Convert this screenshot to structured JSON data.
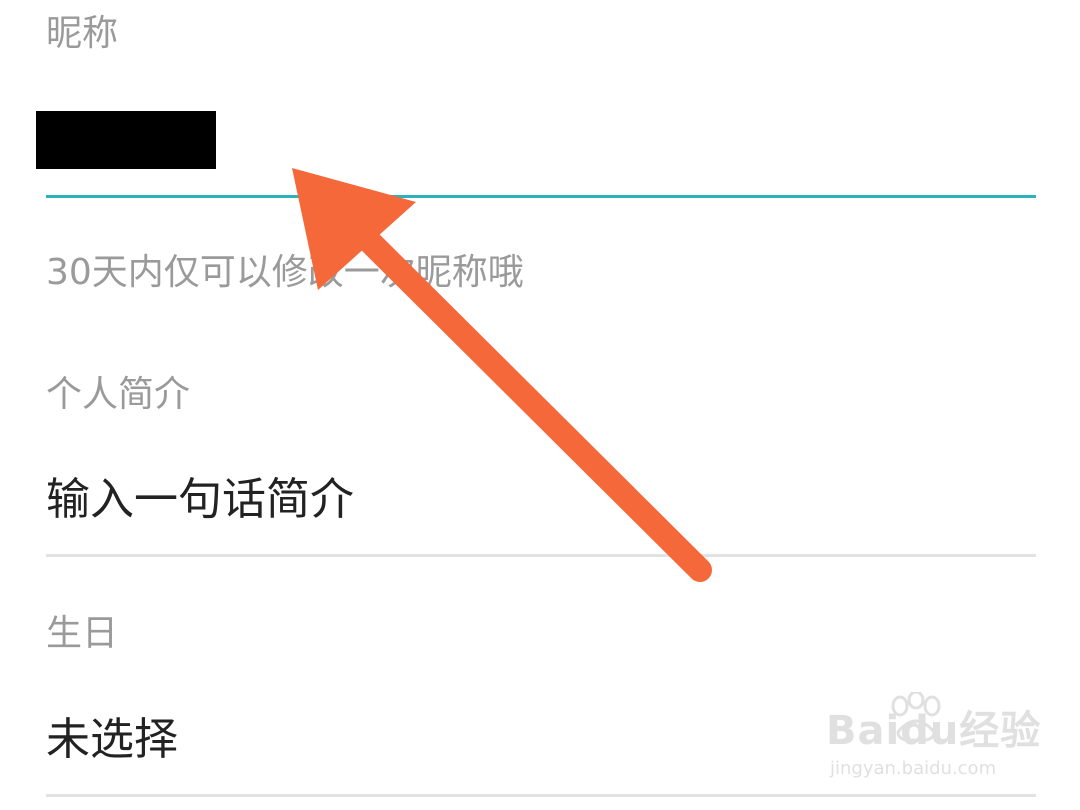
{
  "nickname": {
    "label": "昵称",
    "hint": "30天内仅可以修改一次昵称哦"
  },
  "bio": {
    "label": "个人简介",
    "placeholder": "输入一句话简介"
  },
  "birthday": {
    "label": "生日",
    "value": "未选择"
  },
  "watermark": {
    "brand": "Baidu经验",
    "url": "jingyan.baidu.com"
  },
  "colors": {
    "accent_line": "#2cb2bc",
    "arrow": "#f4683a",
    "label_gray": "#9a9a9a",
    "value_text": "#222222"
  }
}
